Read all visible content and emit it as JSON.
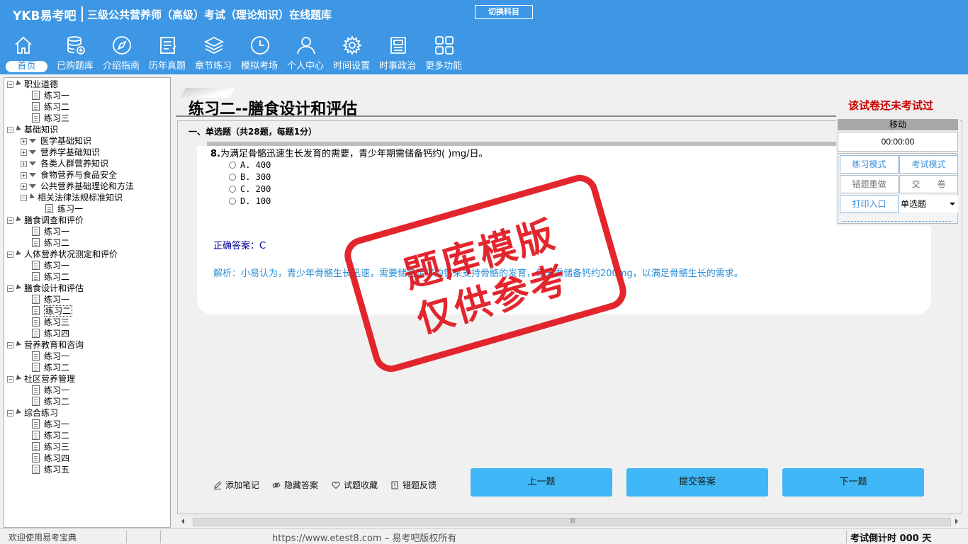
{
  "header": {
    "logo": "YKB易考吧",
    "title": "三级公共营养师（高级）考试（理论知识）在线题库",
    "switch_subject": "切换科目"
  },
  "nav": [
    {
      "label": "首页",
      "icon": "home-icon"
    },
    {
      "label": "已购题库",
      "icon": "database-icon"
    },
    {
      "label": "介绍指南",
      "icon": "compass-icon"
    },
    {
      "label": "历年真题",
      "icon": "document-list-icon"
    },
    {
      "label": "章节练习",
      "icon": "layers-icon"
    },
    {
      "label": "模拟考场",
      "icon": "clock-icon"
    },
    {
      "label": "个人中心",
      "icon": "user-icon"
    },
    {
      "label": "时间设置",
      "icon": "gear-icon"
    },
    {
      "label": "时事政治",
      "icon": "newspaper-icon"
    },
    {
      "label": "更多功能",
      "icon": "grid-icon"
    }
  ],
  "tree": [
    {
      "label": "职业道德",
      "level": 0,
      "type": "folder"
    },
    {
      "label": "练习一",
      "level": 1,
      "type": "doc"
    },
    {
      "label": "练习二",
      "level": 1,
      "type": "doc"
    },
    {
      "label": "练习三",
      "level": 1,
      "type": "doc"
    },
    {
      "label": "基础知识",
      "level": 0,
      "type": "folder"
    },
    {
      "label": "医学基础知识",
      "level": 1,
      "type": "subfolder-collapsed"
    },
    {
      "label": "营养学基础知识",
      "level": 1,
      "type": "subfolder-collapsed"
    },
    {
      "label": "各类人群营养知识",
      "level": 1,
      "type": "subfolder-collapsed"
    },
    {
      "label": "食物营养与食品安全",
      "level": 1,
      "type": "subfolder-collapsed"
    },
    {
      "label": "公共营养基础理论和方法",
      "level": 1,
      "type": "subfolder-collapsed"
    },
    {
      "label": "相关法律法规标准知识",
      "level": 1,
      "type": "subfolder-open"
    },
    {
      "label": "练习一",
      "level": 2,
      "type": "doc"
    },
    {
      "label": "膳食调查和评价",
      "level": 0,
      "type": "folder"
    },
    {
      "label": "练习一",
      "level": 1,
      "type": "doc"
    },
    {
      "label": "练习二",
      "level": 1,
      "type": "doc"
    },
    {
      "label": "人体营养状况测定和评价",
      "level": 0,
      "type": "folder"
    },
    {
      "label": "练习一",
      "level": 1,
      "type": "doc"
    },
    {
      "label": "练习二",
      "level": 1,
      "type": "doc"
    },
    {
      "label": "膳食设计和评估",
      "level": 0,
      "type": "folder"
    },
    {
      "label": "练习一",
      "level": 1,
      "type": "doc"
    },
    {
      "label": "练习二",
      "level": 1,
      "type": "doc",
      "selected": true
    },
    {
      "label": "练习三",
      "level": 1,
      "type": "doc"
    },
    {
      "label": "练习四",
      "level": 1,
      "type": "doc"
    },
    {
      "label": "营养教育和咨询",
      "level": 0,
      "type": "folder"
    },
    {
      "label": "练习一",
      "level": 1,
      "type": "doc"
    },
    {
      "label": "练习二",
      "level": 1,
      "type": "doc"
    },
    {
      "label": "社区营养管理",
      "level": 0,
      "type": "folder"
    },
    {
      "label": "练习一",
      "level": 1,
      "type": "doc"
    },
    {
      "label": "练习二",
      "level": 1,
      "type": "doc"
    },
    {
      "label": "综合练习",
      "level": 0,
      "type": "folder"
    },
    {
      "label": "练习一",
      "level": 1,
      "type": "doc"
    },
    {
      "label": "练习二",
      "level": 1,
      "type": "doc"
    },
    {
      "label": "练习三",
      "level": 1,
      "type": "doc"
    },
    {
      "label": "练习四",
      "level": 1,
      "type": "doc"
    },
    {
      "label": "练习五",
      "level": 1,
      "type": "doc"
    }
  ],
  "paper": {
    "title": "练习二--膳食设计和评估",
    "status": "该试卷还未考试过",
    "section": "一、单选题（共28题，每题1分）"
  },
  "question": {
    "number": "8.",
    "text": "为满足骨骼迅速生长发育的需要，青少年期需储备钙约(  )mg/日。",
    "options": [
      "A. 400",
      "B. 300",
      "C. 200",
      "D. 100"
    ],
    "answer": "正确答案：C",
    "analysis": "解析：小易认为，青少年骨骼生长迅速，需要储备足够的钙来支持骨骼的发育，每天需储备钙约200mg，以满足骨骼生长的需求。"
  },
  "side": {
    "move": "移动",
    "timer": "00:00:00",
    "practice_mode": "练习模式",
    "exam_mode": "考试模式",
    "redo_wrong": "错题重做",
    "submit_paper": "交　　卷",
    "print": "打印入口",
    "type_select": "单选题"
  },
  "watermark": {
    "line1": "题库模版",
    "line2": "仅供参考"
  },
  "tools": {
    "note": "添加笔记",
    "hide_answer": "隐藏答案",
    "favorite": "试题收藏",
    "feedback": "错题反馈"
  },
  "buttons": {
    "prev": "上一题",
    "submit": "提交答案",
    "next": "下一题"
  },
  "status": {
    "welcome": "欢迎使用易考宝典",
    "url": "https://www.etest8.com – 易考吧版权所有",
    "countdown": "考试倒计时 000 天"
  },
  "colors": {
    "header_bg": "#3d97e4",
    "stamp_red": "#e1141c",
    "button_blue": "#3fb6f5",
    "status_red": "#c80000",
    "analysis_blue": "#2a8ed6"
  }
}
